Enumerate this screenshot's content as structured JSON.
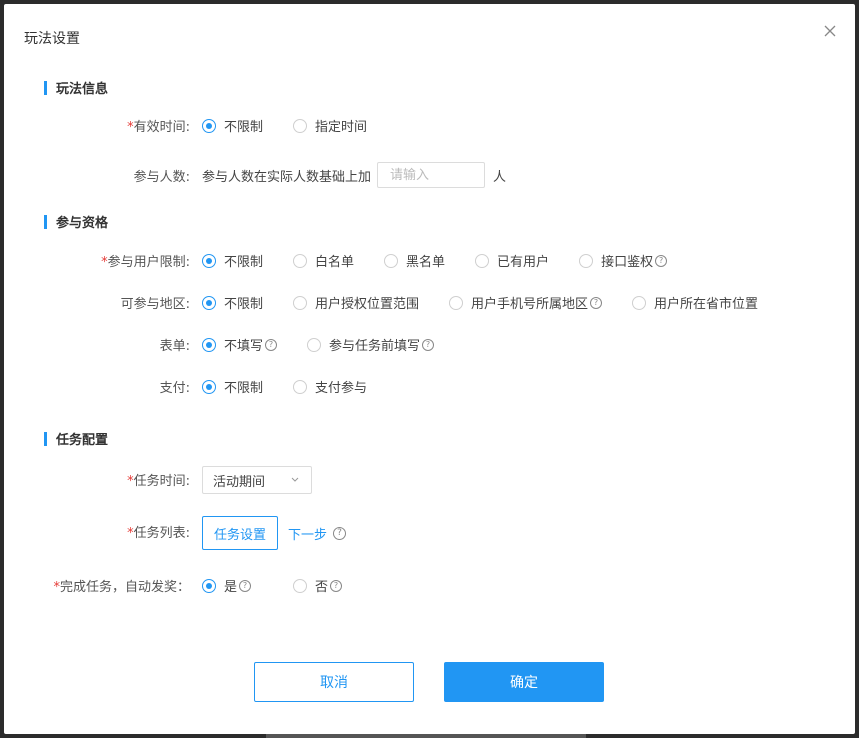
{
  "dialog": {
    "title": "玩法设置"
  },
  "sections": {
    "info": "玩法信息",
    "qualification": "参与资格",
    "task": "任务配置"
  },
  "valid_time": {
    "label": "有效时间:",
    "options": [
      "不限制",
      "指定时间"
    ],
    "selected": "不限制"
  },
  "participants": {
    "label": "参与人数:",
    "prefix": "参与人数在实际人数基础上加",
    "placeholder": "请输入",
    "suffix": "人"
  },
  "user_limit": {
    "label": "参与用户限制:",
    "options": [
      "不限制",
      "白名单",
      "黑名单",
      "已有用户",
      "接口鉴权"
    ],
    "selected": "不限制"
  },
  "region": {
    "label": "可参与地区:",
    "options": [
      "不限制",
      "用户授权位置范围",
      "用户手机号所属地区",
      "用户所在省市位置"
    ],
    "selected": "不限制"
  },
  "form": {
    "label": "表单:",
    "options": [
      "不填写",
      "参与任务前填写"
    ],
    "selected": "不填写"
  },
  "payment": {
    "label": "支付:",
    "options": [
      "不限制",
      "支付参与"
    ],
    "selected": "不限制"
  },
  "task_time": {
    "label": "任务时间:",
    "value": "活动期间"
  },
  "task_list": {
    "label": "任务列表:",
    "button": "任务设置",
    "link": "下一步"
  },
  "auto_reward": {
    "label": "完成任务，自动发奖：",
    "options": [
      "是",
      "否"
    ],
    "selected": "是"
  },
  "footer": {
    "cancel": "取消",
    "confirm": "确定"
  },
  "symbols": {
    "required": "*",
    "help": "?",
    "close": "close-icon",
    "chevron": "chevron-down-icon"
  },
  "colors": {
    "accent": "#2196f3",
    "required": "#e53935"
  }
}
